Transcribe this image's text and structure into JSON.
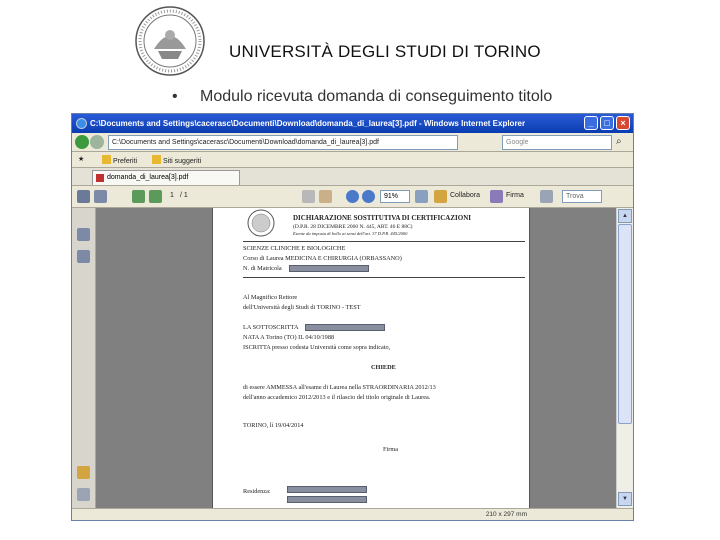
{
  "slide": {
    "title": "UNIVERSITÀ DEGLI STUDI DI TORINO",
    "bullet": "•",
    "subtitle": "Modulo ricevuta domanda di conseguimento titolo"
  },
  "browser": {
    "window_title": "C:\\Documents and Settings\\cacerasc\\Documenti\\Download\\domanda_di_laurea[3].pdf - Windows Internet Explorer",
    "address": "C:\\Documents and Settings\\cacerasc\\Documenti\\Download\\domanda_di_laurea[3].pdf",
    "search_placeholder": "Google",
    "favorites": [
      {
        "label": "Preferiti"
      },
      {
        "label": "Siti suggeriti"
      }
    ],
    "tab_label": "domanda_di_laurea[3].pdf",
    "toolbar": {
      "page_num": "1",
      "page_total": "/ 1",
      "zoom": "91%",
      "collaborate": "Collabora",
      "sign": "Firma",
      "find_placeholder": "Trova"
    },
    "status_dims": "210 x 297 mm"
  },
  "document": {
    "heading": "DICHIARAZIONE SOSTITUTIVA DI CERTIFICAZIONI",
    "heading_ref": "(D.P.R. 28 DICEMBRE 2000 N. 445, ART. 46 E 88C)",
    "heading_note": "Esente da imposta di bollo ai sensi dell'art. 37 D.P.R. 445/2000",
    "faculty": "SCIENZE CLINICHE E BIOLOGICHE",
    "course_label": "Corso di Laurea",
    "course_value": "MEDICINA E CHIRURGIA (ORBASSANO)",
    "matricola_label": "N. di Matricola",
    "recipient_1": "Al Magnifico Rettore",
    "recipient_2": "dell'Università degli Studi di TORINO - TEST",
    "signer_label": "LA SOTTOSCRITTA",
    "birth": "NATA A Torino (TO) IL 04/10/1988",
    "enrolled": "ISCRITTA presso codesta Università come sopra indicato,",
    "asks": "CHIEDE",
    "request_1": "di essere AMMESSA all'esame di Laurea nella STRAORDINARIA 2012/13",
    "request_2": "dell'anno accademico 2012/2013 e il rilascio del titolo originale di Laurea.",
    "place_date": "TORINO, lì 19/04/2014",
    "signature_label": "Firma",
    "residence_label": "Residenza:"
  }
}
